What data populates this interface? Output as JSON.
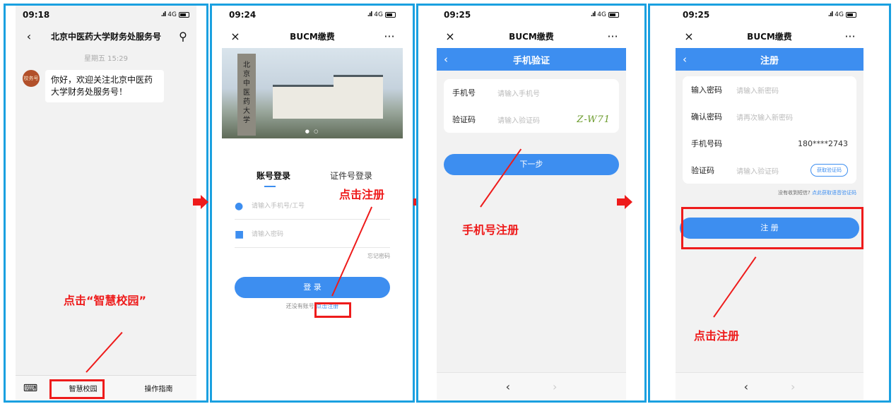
{
  "panel1": {
    "time": "09:18",
    "signal": "4G",
    "back_icon": "chevron-left-icon",
    "title": "北京中医药大学财务处服务号",
    "date": "星期五 15:29",
    "avatar_text": "校务号",
    "message": "你好，欢迎关注北京中医药大学财务处服务号！",
    "menu_items": [
      "智慧校园",
      "操作指南"
    ],
    "note": "点击“智慧校园”"
  },
  "panel2": {
    "time": "09:24",
    "signal": "4G",
    "title": "BUCM缴费",
    "more": "···",
    "close": "×",
    "inscription": "北京中医药大学",
    "tabs": [
      "账号登录",
      "证件号登录"
    ],
    "phone_placeholder": "请输入手机号/工号",
    "password_placeholder": "请输入密码",
    "forgot": "忘记密码",
    "login_button": "登 录",
    "no_account": "还没有账号",
    "register_link": "点击注册",
    "note": "点击注册"
  },
  "panel3": {
    "time": "09:25",
    "signal": "4G",
    "title": "BUCM缴费",
    "more": "···",
    "close": "×",
    "header": "手机验证",
    "phone_label": "手机号",
    "phone_placeholder": "请输入手机号",
    "code_label": "验证码",
    "code_placeholder": "请输入验证码",
    "captcha": "Z-W71",
    "next_button": "下一步",
    "note": "手机号注册",
    "nav_back": "‹",
    "nav_forward": "›"
  },
  "panel4": {
    "time": "09:25",
    "signal": "4G",
    "title": "BUCM缴费",
    "more": "···",
    "close": "×",
    "header": "注册",
    "pwd_label": "输入密码",
    "pwd_placeholder": "请输入新密码",
    "confirm_label": "确认密码",
    "confirm_placeholder": "请再次输入新密码",
    "phone_label": "手机号码",
    "phone_value": "180****2743",
    "code_label": "验证码",
    "code_placeholder": "请输入验证码",
    "get_code": "获取验证码",
    "hint_prefix": "没有收到短信?",
    "hint_link": "点此获取语音验证码",
    "register_button": "注 册",
    "note": "点击注册",
    "nav_back": "‹",
    "nav_forward": "›"
  },
  "colors": {
    "frame": "#1aa0e0",
    "accent": "#3d8ef0",
    "annotation": "#ee1b1b"
  }
}
